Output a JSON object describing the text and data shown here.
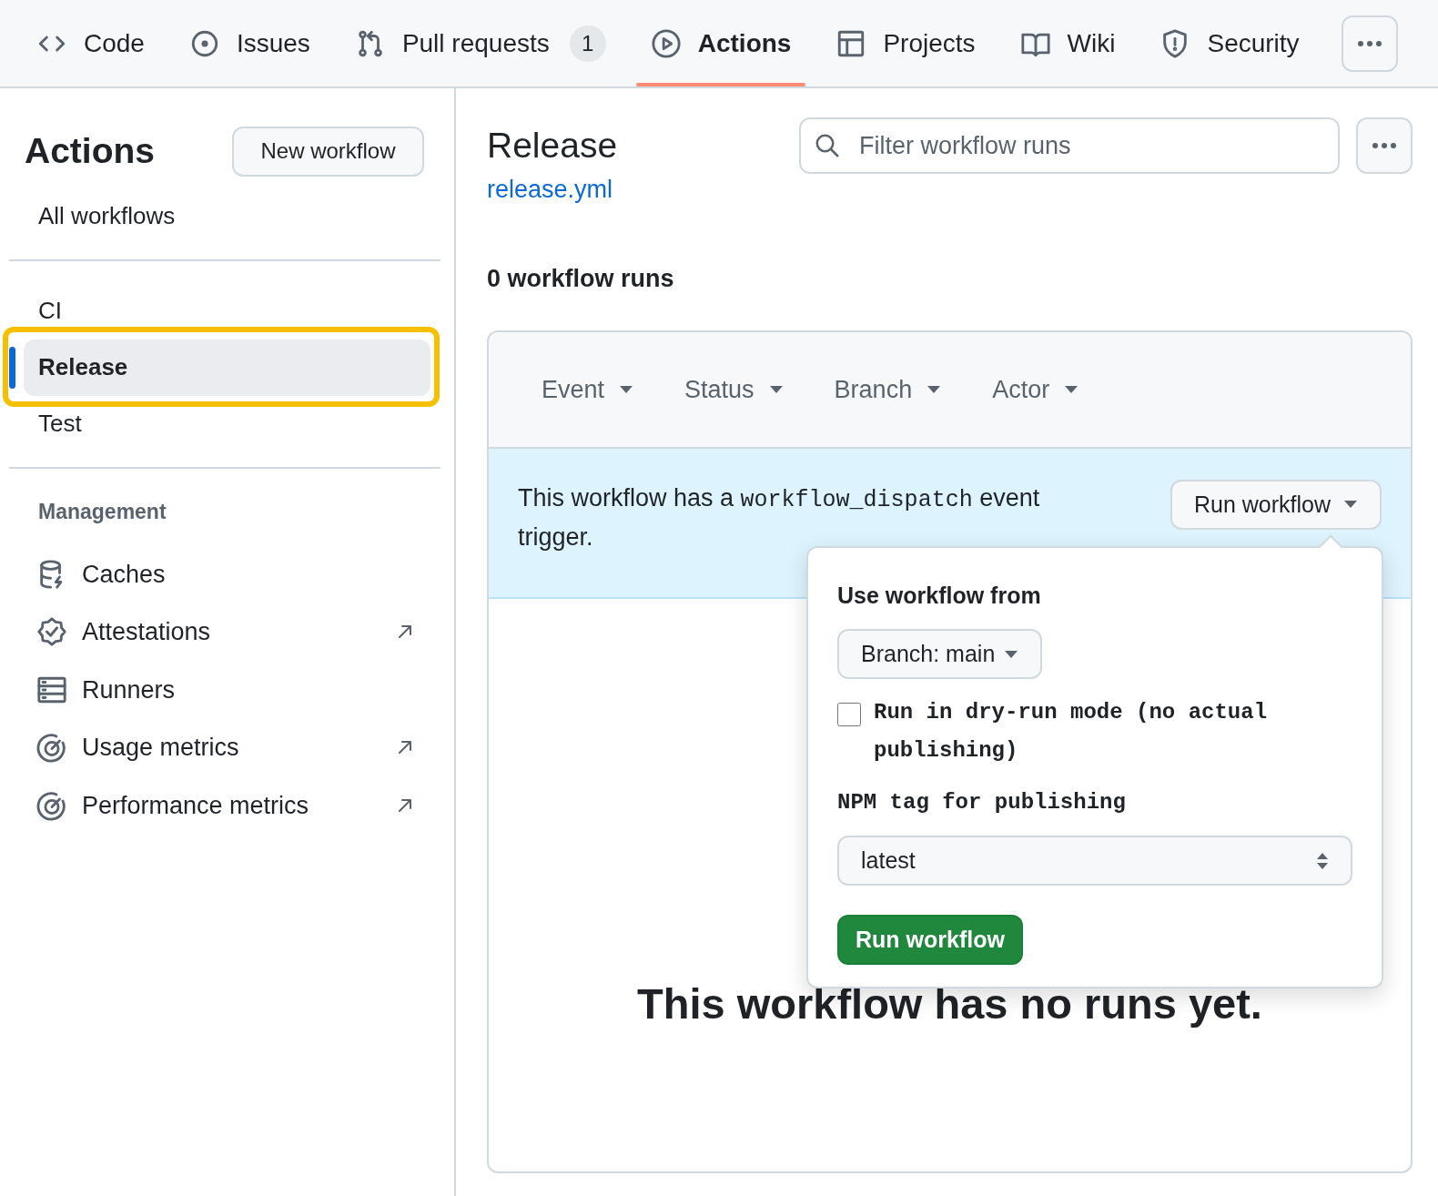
{
  "nav": {
    "tabs": [
      {
        "label": "Code",
        "selected": false
      },
      {
        "label": "Issues",
        "selected": false
      },
      {
        "label": "Pull requests",
        "counter": "1",
        "selected": false
      },
      {
        "label": "Actions",
        "selected": true
      },
      {
        "label": "Projects",
        "selected": false
      },
      {
        "label": "Wiki",
        "selected": false
      },
      {
        "label": "Security",
        "selected": false
      }
    ]
  },
  "sidebar": {
    "title": "Actions",
    "new_button": "New workflow",
    "all_workflows": "All workflows",
    "workflows": [
      {
        "label": "CI",
        "selected": false,
        "highlighted": false
      },
      {
        "label": "Release",
        "selected": true,
        "highlighted": true
      },
      {
        "label": "Test",
        "selected": false,
        "highlighted": false
      }
    ],
    "management": {
      "heading": "Management",
      "items": [
        {
          "label": "Caches",
          "external": false
        },
        {
          "label": "Attestations",
          "external": true
        },
        {
          "label": "Runners",
          "external": false
        },
        {
          "label": "Usage metrics",
          "external": true
        },
        {
          "label": "Performance metrics",
          "external": true
        }
      ]
    }
  },
  "main": {
    "title": "Release",
    "file_link": "release.yml",
    "search": {
      "placeholder": "Filter workflow runs"
    },
    "run_count": "0 workflow runs",
    "filters": [
      "Event",
      "Status",
      "Branch",
      "Actor"
    ],
    "banner": {
      "text_before": "This workflow has a",
      "code": "workflow_dispatch",
      "text_after": "event trigger.",
      "button": "Run workflow"
    },
    "popup": {
      "heading": "Use workflow from",
      "branch_button": "Branch: main",
      "inputs": [
        {
          "kind": "checkbox",
          "label": "Run in dry-run mode (no actual publishing)",
          "checked": false
        },
        {
          "kind": "select",
          "label": "NPM tag for publishing",
          "value": "latest"
        }
      ],
      "submit": "Run workflow"
    },
    "empty_message": "This workflow has no runs yet."
  }
}
